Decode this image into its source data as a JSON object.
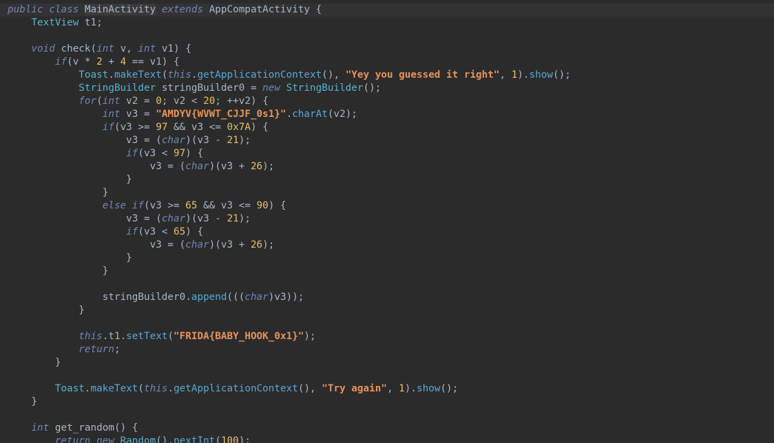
{
  "editor": {
    "class_name": "MainActivity",
    "superclass": "AppCompatActivity",
    "lines": [
      "public class MainActivity extends AppCompatActivity {",
      "    TextView t1;",
      "",
      "    void check(int v, int v1) {",
      "        if(v * 2 + 4 == v1) {",
      "            Toast.makeText(this.getApplicationContext(), \"Yey you guessed it right\", 1).show();",
      "            StringBuilder stringBuilder0 = new StringBuilder();",
      "            for(int v2 = 0; v2 < 20; ++v2) {",
      "                int v3 = \"AMDYV{WVWT_CJJF_0s1}\".charAt(v2);",
      "                if(v3 >= 97 && v3 <= 0x7A) {",
      "                    v3 = (char)(v3 - 21);",
      "                    if(v3 < 97) {",
      "                        v3 = (char)(v3 + 26);",
      "                    }",
      "                }",
      "                else if(v3 >= 65 && v3 <= 90) {",
      "                    v3 = (char)(v3 - 21);",
      "                    if(v3 < 65) {",
      "                        v3 = (char)(v3 + 26);",
      "                    }",
      "                }",
      "",
      "                stringBuilder0.append(((char)v3));",
      "            }",
      "",
      "            this.t1.setText(\"FRIDA{BABY_HOOK_0x1}\");",
      "            return;",
      "        }",
      "",
      "        Toast.makeText(this.getApplicationContext(), \"Try again\", 1).show();",
      "    }",
      "",
      "    int get_random() {",
      "        return new Random().nextInt(100);"
    ]
  },
  "colors": {
    "background": "#2b2b2b",
    "current_line": "#323232",
    "default_text": "#a9b7c6",
    "keyword": "#6f86b8",
    "type": "#58b3cf",
    "method": "#56a8d8",
    "string": "#e8935a",
    "number": "#e8bf6a"
  }
}
